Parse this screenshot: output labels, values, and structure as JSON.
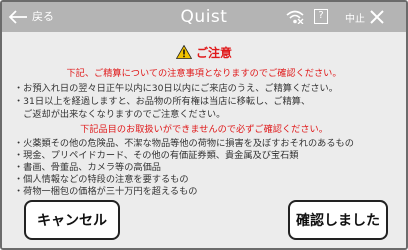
{
  "header": {
    "back_label": "戻る",
    "app_title": "Quist",
    "help_label": "?",
    "stop_label": "中止"
  },
  "notice": {
    "title": "ご注意",
    "intro": "下記、ご精算についての注意事項となりますのでご確認ください。",
    "points": [
      "・お預入れ日の翌々日正午以内に30日以内にご来店のうえ、ご精算ください。",
      "・31日以上を経過しますと、お品物の所有権は当店に移転し、ご精算、",
      "　ご返却が出来なくなりますのでご注意ください。"
    ],
    "restricted_heading": "下記品目のお取扱いができませんので必ずご確認ください。",
    "restricted_items": [
      "・火薬類その他の危険品、不潔な物品等他の荷物に損害を及ぼすおそれのあるもの",
      "・現金、プリペイドカード、その他の有価証券類、貴金属及び宝石類",
      "・書画、骨董品、カメラ等の高価品",
      "・個人情報などの特段の注意を要するもの",
      "・荷物一梱包の価格が三十万円を超えるもの"
    ]
  },
  "buttons": {
    "cancel": "キャンセル",
    "confirm": "確認しました"
  },
  "colors": {
    "header_bg": "#b4b4b4",
    "panel_bg": "#ececec",
    "warning_red": "#e0191a",
    "warning_yellow": "#f2c200"
  },
  "icons": {
    "back": "arrow-left-icon",
    "wifi": "wifi-icon",
    "help": "help-icon",
    "close": "close-icon",
    "warning": "warning-icon"
  }
}
